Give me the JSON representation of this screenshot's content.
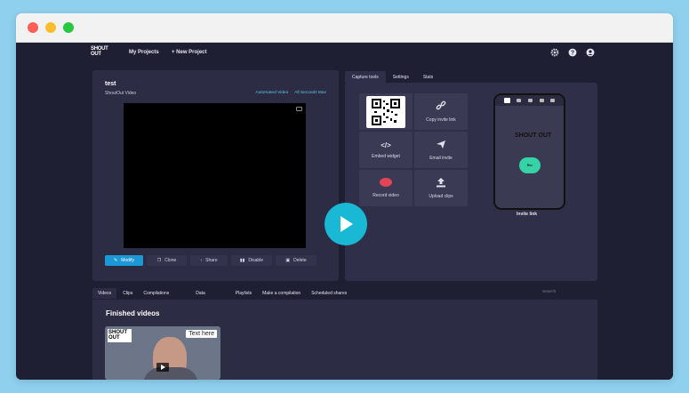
{
  "nav": {
    "brand": "SHOUT OUT",
    "my_projects": "My Projects",
    "new_project": "+ New Project",
    "icons": [
      "gear-icon",
      "help-icon",
      "user-icon"
    ]
  },
  "project": {
    "title": "test",
    "subtitle": "ShoutOut Video",
    "link1": "Automated Video",
    "link2": "All Seconds Max",
    "actions": [
      {
        "label": "Modify",
        "icon": "edit-icon"
      },
      {
        "label": "Clone",
        "icon": "copy-icon"
      },
      {
        "label": "Share",
        "icon": "share-icon"
      },
      {
        "label": "Disable",
        "icon": "pause-icon"
      },
      {
        "label": "Delete",
        "icon": "trash-icon"
      }
    ]
  },
  "capture": {
    "tabs": [
      "Capture tools",
      "Settings",
      "Stats"
    ],
    "tools": [
      {
        "label": "",
        "icon": "qr-code"
      },
      {
        "label": "Copy invite link",
        "icon": "link-icon"
      },
      {
        "label": "Embed widget",
        "icon": "code-icon"
      },
      {
        "label": "Email invite",
        "icon": "send-icon"
      },
      {
        "label": "Record video",
        "icon": "record-icon"
      },
      {
        "label": "Upload clips",
        "icon": "upload-icon"
      }
    ],
    "phone_brand": "SHOUT OUT",
    "phone_button": "Rec",
    "invite_caption": "Invite link"
  },
  "bottom": {
    "tabs": [
      "Videos",
      "Clips",
      "Compilations",
      "Data",
      "Playlists",
      "Make a compilation",
      "Scheduled shares"
    ],
    "search_placeholder": "Search",
    "section_title": "Finished videos",
    "thumb_logo": "SHOUT OUT",
    "thumb_text": "Text here"
  },
  "colors": {
    "accent": "#19b8d4",
    "primary_button": "#1d98d6",
    "record_red": "#e04455",
    "record_green": "#36d3a6",
    "background": "#1f1f33"
  }
}
